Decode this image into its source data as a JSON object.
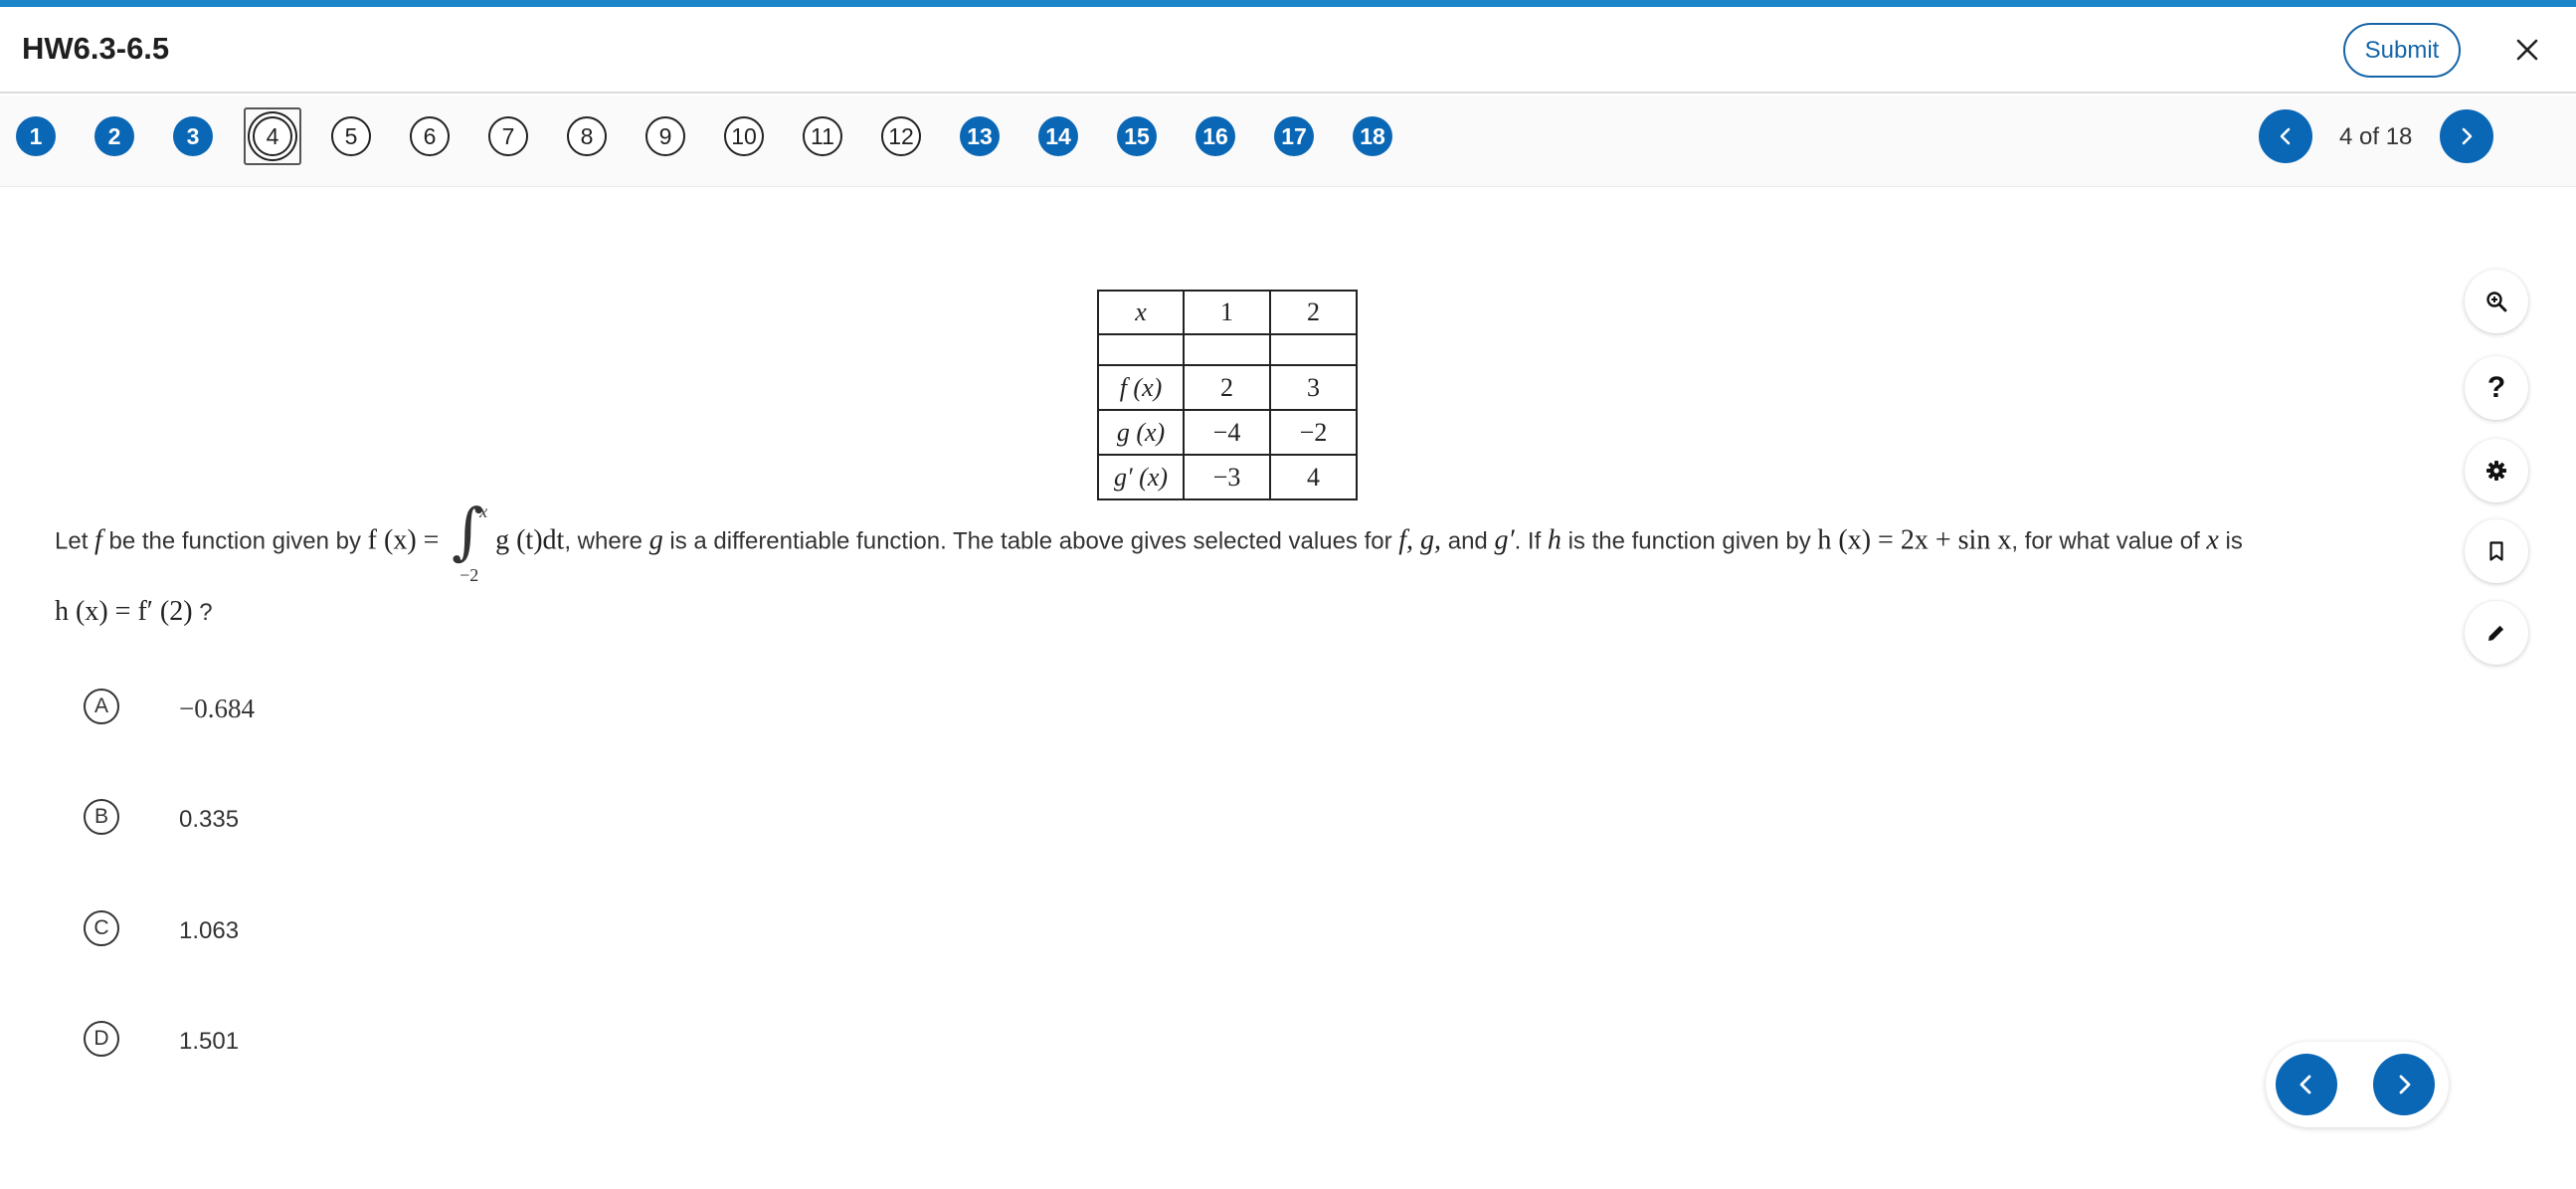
{
  "header": {
    "title": "HW6.3-6.5",
    "submit_label": "Submit",
    "close_icon": "close-icon"
  },
  "question_nav": {
    "items": [
      {
        "label": "1",
        "state": "answered"
      },
      {
        "label": "2",
        "state": "answered"
      },
      {
        "label": "3",
        "state": "answered"
      },
      {
        "label": "4",
        "state": "current"
      },
      {
        "label": "5",
        "state": "unanswered"
      },
      {
        "label": "6",
        "state": "unanswered"
      },
      {
        "label": "7",
        "state": "unanswered"
      },
      {
        "label": "8",
        "state": "unanswered"
      },
      {
        "label": "9",
        "state": "unanswered"
      },
      {
        "label": "10",
        "state": "unanswered"
      },
      {
        "label": "11",
        "state": "unanswered"
      },
      {
        "label": "12",
        "state": "unanswered"
      },
      {
        "label": "13",
        "state": "answered"
      },
      {
        "label": "14",
        "state": "answered"
      },
      {
        "label": "15",
        "state": "answered"
      },
      {
        "label": "16",
        "state": "answered"
      },
      {
        "label": "17",
        "state": "answered"
      },
      {
        "label": "18",
        "state": "answered"
      }
    ],
    "page_count": "4 of 18",
    "prev_icon": "chevron-left-icon",
    "next_icon": "chevron-right-icon"
  },
  "table": {
    "header": [
      "x",
      "1",
      "2"
    ],
    "rows": [
      [
        "",
        "",
        ""
      ],
      [
        "f (x)",
        "2",
        "3"
      ],
      [
        "g (x)",
        "−4",
        "−2"
      ],
      [
        "g′ (x)",
        "−3",
        "4"
      ]
    ]
  },
  "question": {
    "t1": "Let ",
    "f": "f",
    "t2": " be the function given by ",
    "fx": "f (x) =",
    "int_upper": "x",
    "int_lower": "−2",
    "integrand": "g (t)dt",
    "t3": ", where ",
    "g": "g",
    "t4": " is a differentiable function. The table above gives selected values for ",
    "fgg": "f, g,",
    "t5": " and ",
    "gp": "g′",
    "t6": ". If ",
    "h": "h",
    "t7": " is the function given by ",
    "hx": "h (x) = 2x + sin x",
    "t8": ", for what value of ",
    "x": "x",
    "t9": " is",
    "line2_math": "h (x) = f′ (2)",
    "line2_end": " ?"
  },
  "choices": [
    {
      "letter": "A",
      "value": "−0.684"
    },
    {
      "letter": "B",
      "value": "0.335"
    },
    {
      "letter": "C",
      "value": "1.063"
    },
    {
      "letter": "D",
      "value": "1.501"
    }
  ],
  "tools": [
    "zoom-in-icon",
    "help-icon",
    "settings-icon",
    "bookmark-icon",
    "pencil-icon"
  ],
  "tool_help_glyph": "?",
  "colors": {
    "accent": "#1a86c8",
    "primary": "#0a67b5"
  }
}
